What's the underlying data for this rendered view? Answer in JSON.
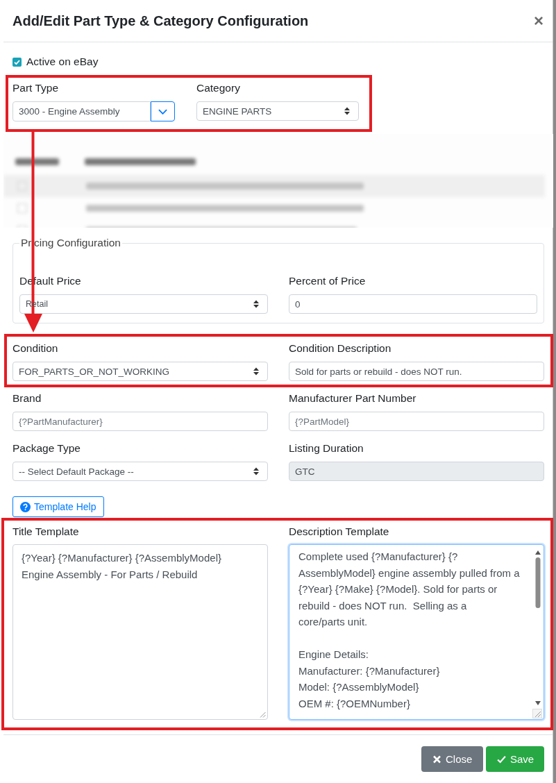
{
  "modal": {
    "title": "Add/Edit Part Type & Category Configuration",
    "close": "×"
  },
  "active": {
    "label": "Active on eBay",
    "checked": true
  },
  "part_row": {
    "highlighted": true,
    "part_type": {
      "label": "Part Type",
      "value": "3000 - Engine Assembly"
    },
    "category": {
      "label": "Category",
      "value": "ENGINE PARTS"
    }
  },
  "pricing": {
    "legend": "Pricing Configuration",
    "default_price": {
      "label": "Default Price",
      "value": "Retail"
    },
    "percent": {
      "label": "Percent of Price",
      "value": "0"
    }
  },
  "condition_row": {
    "highlighted": true,
    "condition": {
      "label": "Condition",
      "value": "FOR_PARTS_OR_NOT_WORKING"
    },
    "description": {
      "label": "Condition Description",
      "value": "Sold for parts or rebuild - does NOT run."
    }
  },
  "brand": {
    "label": "Brand",
    "placeholder": "{?PartManufacturer}"
  },
  "mpn": {
    "label": "Manufacturer Part Number",
    "placeholder": "{?PartModel}"
  },
  "package": {
    "label": "Package Type",
    "value": "-- Select Default Package --"
  },
  "duration": {
    "label": "Listing Duration",
    "value": "GTC",
    "disabled": true
  },
  "help_button": {
    "label": "Template Help"
  },
  "templates": {
    "highlighted": true,
    "title": {
      "label": "Title Template",
      "value": "{?Year} {?Manufacturer} {?AssemblyModel} Engine Assembly - For Parts / Rebuild"
    },
    "description": {
      "label": "Description Template",
      "value": "Complete used {?Manufacturer} {?AssemblyModel} engine assembly pulled from a {?Year} {?Make} {?Model}. Sold for parts or rebuild - does NOT run.  Selling as a\ncore/parts unit.\n\nEngine Details:\nManufacturer: {?Manufacturer}\nModel: {?AssemblyModel}\nOEM #: {?OEMNumber}",
      "focused": true
    }
  },
  "footer": {
    "buttons": [
      {
        "kind": "close",
        "label": "Close"
      },
      {
        "kind": "save",
        "label": "Save"
      }
    ]
  }
}
